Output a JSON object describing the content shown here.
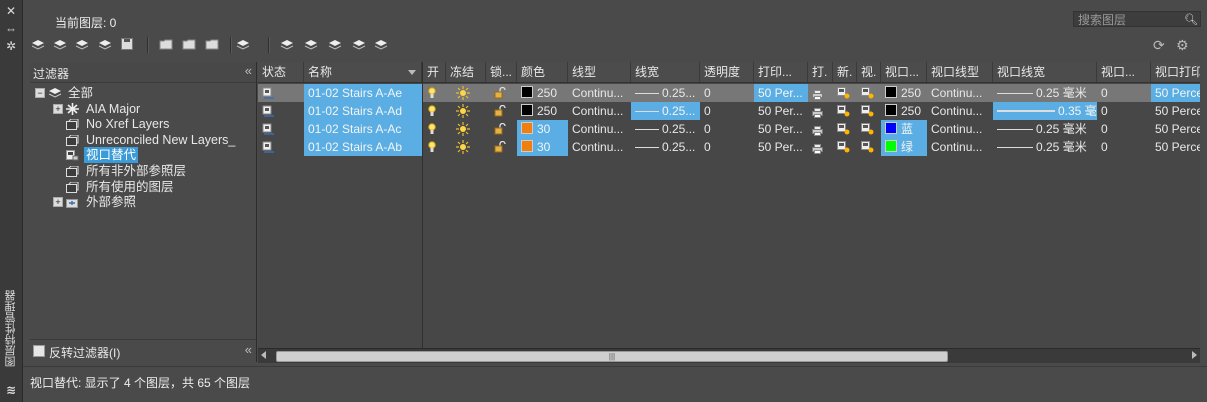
{
  "window": {
    "vertical_title": "图层特性管理器"
  },
  "header": {
    "current_layer": "当前图层: 0",
    "search_placeholder": "搜索图层"
  },
  "filter_panel": {
    "title": "过滤器",
    "tree": [
      {
        "label": "全部",
        "level": 0,
        "expand": "−",
        "icon": "layers-stack-icon"
      },
      {
        "label": "AIA Major",
        "level": 1,
        "expand": "+",
        "icon": "group-filter-icon"
      },
      {
        "label": "No Xref Layers",
        "level": 1,
        "expand": "",
        "icon": "property-filter-icon"
      },
      {
        "label": "Unreconciled New Layers_",
        "level": 1,
        "expand": "",
        "icon": "property-filter-icon"
      },
      {
        "label": "视口替代",
        "level": 1,
        "expand": "",
        "icon": "viewport-override-icon",
        "selected": true
      },
      {
        "label": "所有非外部参照层",
        "level": 1,
        "expand": "",
        "icon": "property-filter-icon"
      },
      {
        "label": "所有使用的图层",
        "level": 1,
        "expand": "",
        "icon": "property-filter-icon"
      },
      {
        "label": "外部参照",
        "level": 1,
        "expand": "+",
        "icon": "xref-icon"
      }
    ],
    "invert_label": "反转过滤器(I)"
  },
  "grid": {
    "headers": [
      "状态",
      "名称",
      "开",
      "冻结",
      "锁...",
      "颜色",
      "线型",
      "线宽",
      "透明度",
      "打印...",
      "打.",
      "新.",
      "视.",
      "视口...",
      "视口线型",
      "视口线宽",
      "视口...",
      "视口打印"
    ],
    "rows": [
      {
        "name": "01-02 Stairs A-Ae",
        "color": "250",
        "color_hex": "#000000",
        "linetype": "Continu...",
        "lineweight": "0.25...",
        "transparency": "0",
        "plot_style": "50 Per...",
        "vp_color": "250",
        "vp_color_hex": "#000000",
        "vp_linetype": "Continu...",
        "vp_lineweight": "0.25 毫米",
        "vp_transparency": "0",
        "vp_plot_style": "50 Perce",
        "current": true
      },
      {
        "name": "01-02 Stairs A-Ad",
        "color": "250",
        "color_hex": "#000000",
        "linetype": "Continu...",
        "lineweight": "0.25...",
        "transparency": "0",
        "plot_style": "50 Per...",
        "vp_color": "250",
        "vp_color_hex": "#000000",
        "vp_linetype": "Continu...",
        "vp_lineweight": "0.35 毫米",
        "vp_transparency": "0",
        "vp_plot_style": "50 Perce"
      },
      {
        "name": "01-02 Stairs A-Ac",
        "color": "30",
        "color_hex": "#f07f10",
        "linetype": "Continu...",
        "lineweight": "0.25...",
        "transparency": "0",
        "plot_style": "50 Per...",
        "vp_color": "蓝",
        "vp_color_hex": "#0000ff",
        "vp_linetype": "Continu...",
        "vp_lineweight": "0.25 毫米",
        "vp_transparency": "0",
        "vp_plot_style": "50 Perce"
      },
      {
        "name": "01-02 Stairs A-Ab",
        "color": "30",
        "color_hex": "#f07f10",
        "linetype": "Continu...",
        "lineweight": "0.25...",
        "transparency": "0",
        "plot_style": "50 Per...",
        "vp_color": "绿",
        "vp_color_hex": "#00ff00",
        "vp_linetype": "Continu...",
        "vp_lineweight": "0.25 毫米",
        "vp_transparency": "0",
        "vp_plot_style": "50 Perce"
      }
    ]
  },
  "status_bar": {
    "text": "视口替代: 显示了 4 个图层，共 65 个图层"
  },
  "colors": {
    "selection": "#5aaee3",
    "tree_selection": "#3b9ad8",
    "background": "#4a4a4a"
  }
}
